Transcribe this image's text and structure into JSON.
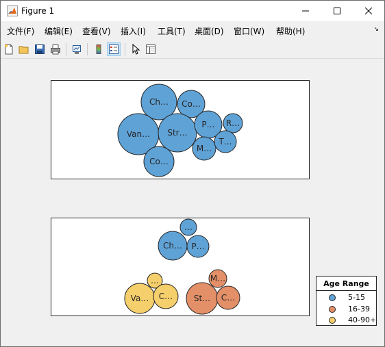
{
  "window": {
    "title": "Figure 1"
  },
  "menu": [
    {
      "label": "文件(F)",
      "name": "menu-file"
    },
    {
      "label": "编辑(E)",
      "name": "menu-edit"
    },
    {
      "label": "查看(V)",
      "name": "menu-view"
    },
    {
      "label": "插入(I)",
      "name": "menu-insert"
    },
    {
      "label": "工具(T)",
      "name": "menu-tools"
    },
    {
      "label": "桌面(D)",
      "name": "menu-desktop"
    },
    {
      "label": "窗口(W)",
      "name": "menu-window"
    },
    {
      "label": "帮助(H)",
      "name": "menu-help"
    }
  ],
  "toolbar": [
    {
      "icon": "new-figure-icon"
    },
    {
      "icon": "open-file-icon"
    },
    {
      "icon": "save-icon"
    },
    {
      "icon": "print-icon"
    },
    {
      "icon": "link-plot-icon"
    },
    {
      "icon": "colorbar-icon"
    },
    {
      "icon": "legend-icon",
      "active": true
    },
    {
      "icon": "select-arrow-icon"
    },
    {
      "icon": "property-inspector-icon"
    }
  ],
  "colors": {
    "blue": "#5fa2d6",
    "orange": "#e38f68",
    "yellow": "#f5cf6b"
  },
  "chart_data": [
    {
      "type": "bubblecloud",
      "title": "",
      "bubbles": [
        {
          "label": "Ch…",
          "group": "5-15"
        },
        {
          "label": "Co…",
          "group": "5-15"
        },
        {
          "label": "Van…",
          "group": "5-15"
        },
        {
          "label": "Str…",
          "group": "5-15"
        },
        {
          "label": "P…",
          "group": "5-15"
        },
        {
          "label": "R…",
          "group": "5-15"
        },
        {
          "label": "M…",
          "group": "5-15"
        },
        {
          "label": "T…",
          "group": "5-15"
        },
        {
          "label": "Co…",
          "group": "5-15"
        }
      ]
    },
    {
      "type": "bubblecloud",
      "title": "",
      "bubbles": [
        {
          "label": "…",
          "group": "5-15"
        },
        {
          "label": "Ch…",
          "group": "5-15"
        },
        {
          "label": "P…",
          "group": "5-15"
        },
        {
          "label": "…",
          "group": "40-90+"
        },
        {
          "label": "Va…",
          "group": "40-90+"
        },
        {
          "label": "C…",
          "group": "40-90+"
        },
        {
          "label": "M…",
          "group": "16-39"
        },
        {
          "label": "St…",
          "group": "16-39"
        },
        {
          "label": "C…",
          "group": "16-39"
        }
      ],
      "legend": {
        "title": "Age Range",
        "entries": [
          {
            "label": "5-15",
            "color": "#5fa2d6"
          },
          {
            "label": "16-39",
            "color": "#e38f68"
          },
          {
            "label": "40-90+",
            "color": "#f5cf6b"
          }
        ]
      }
    }
  ]
}
